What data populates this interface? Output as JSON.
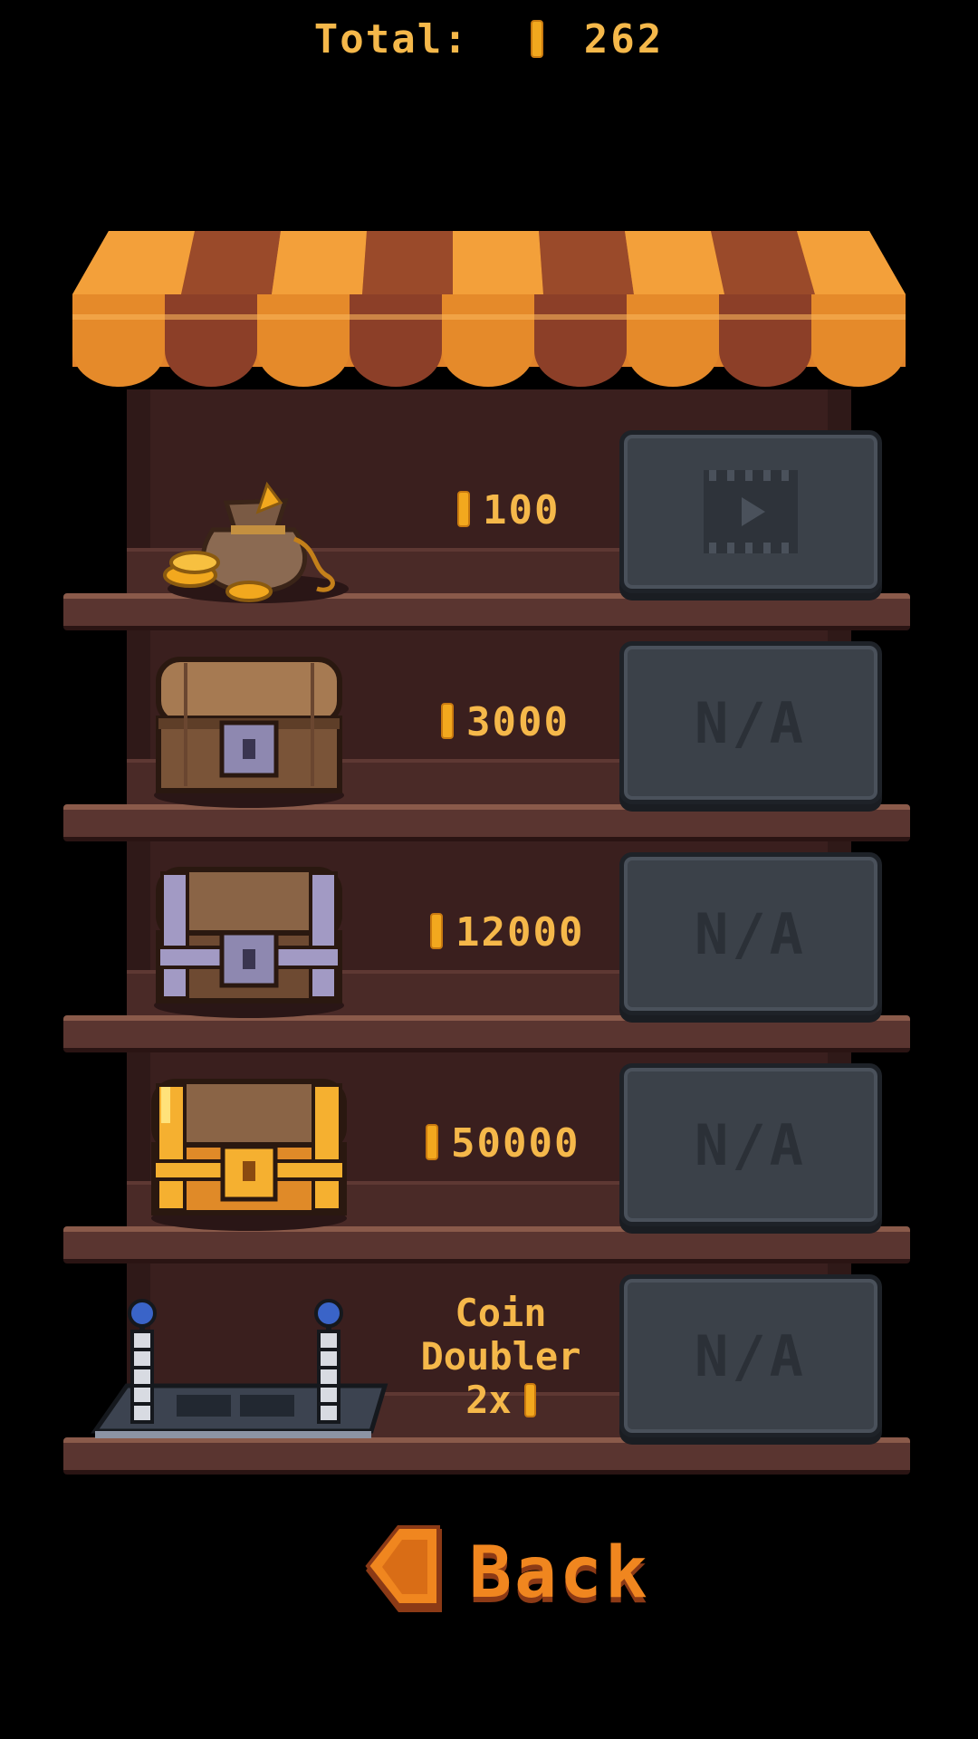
{
  "header": {
    "label": "Total:",
    "coins": "262"
  },
  "shop": {
    "items": [
      {
        "name": "coin-bag",
        "price": "100",
        "action": "video"
      },
      {
        "name": "wooden-chest",
        "price": "3000",
        "action": "N/A"
      },
      {
        "name": "iron-chest",
        "price": "12000",
        "action": "N/A"
      },
      {
        "name": "golden-chest",
        "price": "50000",
        "action": "N/A"
      },
      {
        "name": "coin-doubler",
        "label_lines": [
          "Coin",
          "Doubler",
          "2x"
        ],
        "action": "N/A"
      }
    ]
  },
  "footer": {
    "back_label": "Back"
  },
  "colors": {
    "accent": "#f5b84a",
    "back": "#f0861f",
    "button": "#3b4149",
    "wood": "#3a1f1e"
  },
  "icons": [
    "coin-icon",
    "video-play-icon",
    "coin-bag-icon",
    "wooden-chest-icon",
    "iron-chest-icon",
    "golden-chest-icon",
    "coin-doubler-icon",
    "back-arrow-icon"
  ]
}
